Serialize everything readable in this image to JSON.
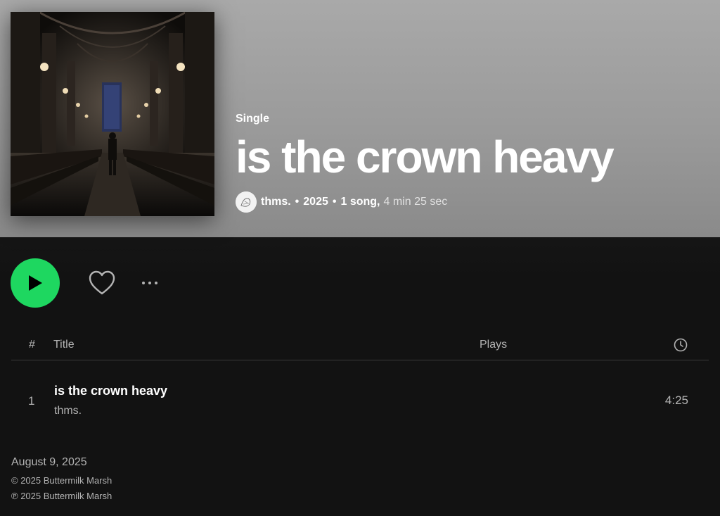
{
  "album": {
    "kind": "Single",
    "title": "is the crown heavy",
    "artist": "thms.",
    "year": "2025",
    "song_count": "1 song,",
    "duration": "4 min 25 sec",
    "dot": "•"
  },
  "colors": {
    "accent": "#1ed760",
    "header_bg": "#9a9a9a",
    "page_bg": "#121212",
    "muted_text": "#b3b3b3"
  },
  "actions": {
    "play_icon": "play-icon",
    "like_icon": "heart-icon",
    "more_icon": "more-options-icon"
  },
  "tracklist": {
    "headers": {
      "number": "#",
      "title": "Title",
      "plays": "Plays",
      "duration_icon": "clock-icon"
    },
    "tracks": [
      {
        "number": "1",
        "title": "is the crown heavy",
        "artist": "thms.",
        "plays": "",
        "duration": "4:25"
      }
    ]
  },
  "footer": {
    "release_date": "August 9, 2025",
    "copyright": "© 2025 Buttermilk Marsh",
    "phonographic": "℗ 2025 Buttermilk Marsh"
  }
}
